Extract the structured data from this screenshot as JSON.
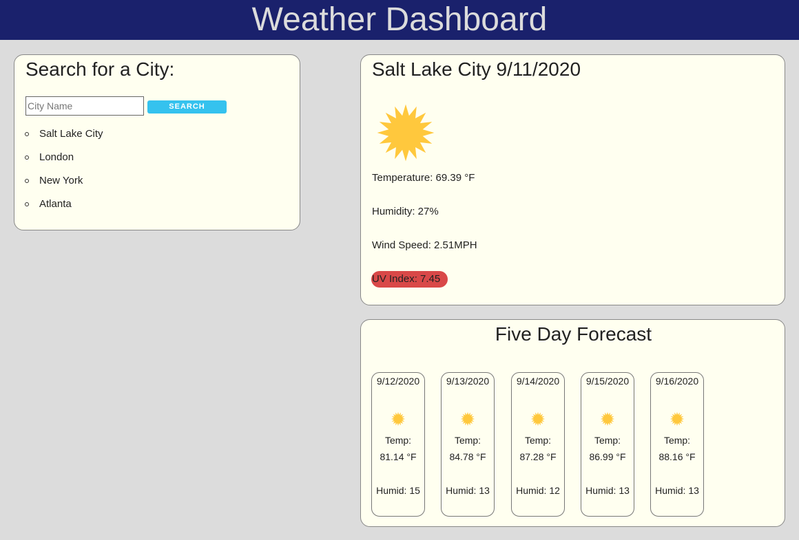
{
  "header": {
    "title": "Weather Dashboard"
  },
  "search": {
    "title": "Search for a City:",
    "placeholder": "City Name",
    "button_label": "SEARCH",
    "history": [
      "Salt Lake City",
      "London",
      "New York",
      "Atlanta"
    ]
  },
  "current": {
    "title": "Salt Lake City 9/11/2020",
    "icon": "sun-icon",
    "temperature": "Temperature: 69.39 °F",
    "humidity": "Humidity: 27%",
    "wind": "Wind Speed: 2.51MPH",
    "uv": "UV Index: 7.45",
    "uv_color": "#d94848"
  },
  "forecast": {
    "title": "Five Day Forecast",
    "temp_label": "Temp:",
    "days": [
      {
        "date": "9/12/2020",
        "icon": "sun-icon",
        "temp": "81.14 °F",
        "humid": "Humid: 15"
      },
      {
        "date": "9/13/2020",
        "icon": "sun-icon",
        "temp": "84.78 °F",
        "humid": "Humid: 13"
      },
      {
        "date": "9/14/2020",
        "icon": "sun-icon",
        "temp": "87.28 °F",
        "humid": "Humid: 12"
      },
      {
        "date": "9/15/2020",
        "icon": "sun-icon",
        "temp": "86.99 °F",
        "humid": "Humid: 13"
      },
      {
        "date": "9/16/2020",
        "icon": "sun-icon",
        "temp": "88.16 °F",
        "humid": "Humid: 13"
      }
    ]
  },
  "colors": {
    "header_bg": "#1a216c",
    "card_bg": "#fffff0",
    "button_bg": "#35c2ee",
    "sun": "#ffc83d"
  }
}
